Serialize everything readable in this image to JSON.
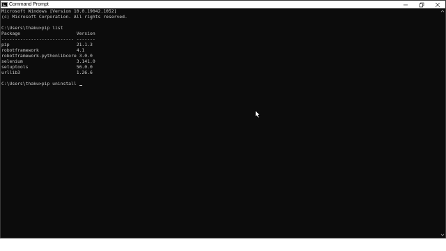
{
  "window": {
    "title": "Command Prompt",
    "icon": "cmd-icon",
    "controls": [
      "minimize-icon",
      "restore-icon",
      "close-icon"
    ]
  },
  "console": {
    "lines": [
      "Microsoft Windows [Version 10.0.19042.1052]",
      "(c) Microsoft Corporation. All rights reserved.",
      "",
      "C:\\Users\\thaku>pip list",
      "Package                     Version",
      "--------------------------- -------",
      "pip                         21.1.3",
      "robotframework              4.1",
      "robotframework-pythonlibcore 3.0.0",
      "selenium                    3.141.0",
      "setuptools                  56.0.0",
      "urllib3                     1.26.6",
      ""
    ],
    "prompt_line": "C:\\Users\\thaku>pip uninstall "
  },
  "colors": {
    "console_bg": "#0c0c0c",
    "console_fg": "#cccccc",
    "titlebar_bg": "#ffffff"
  }
}
